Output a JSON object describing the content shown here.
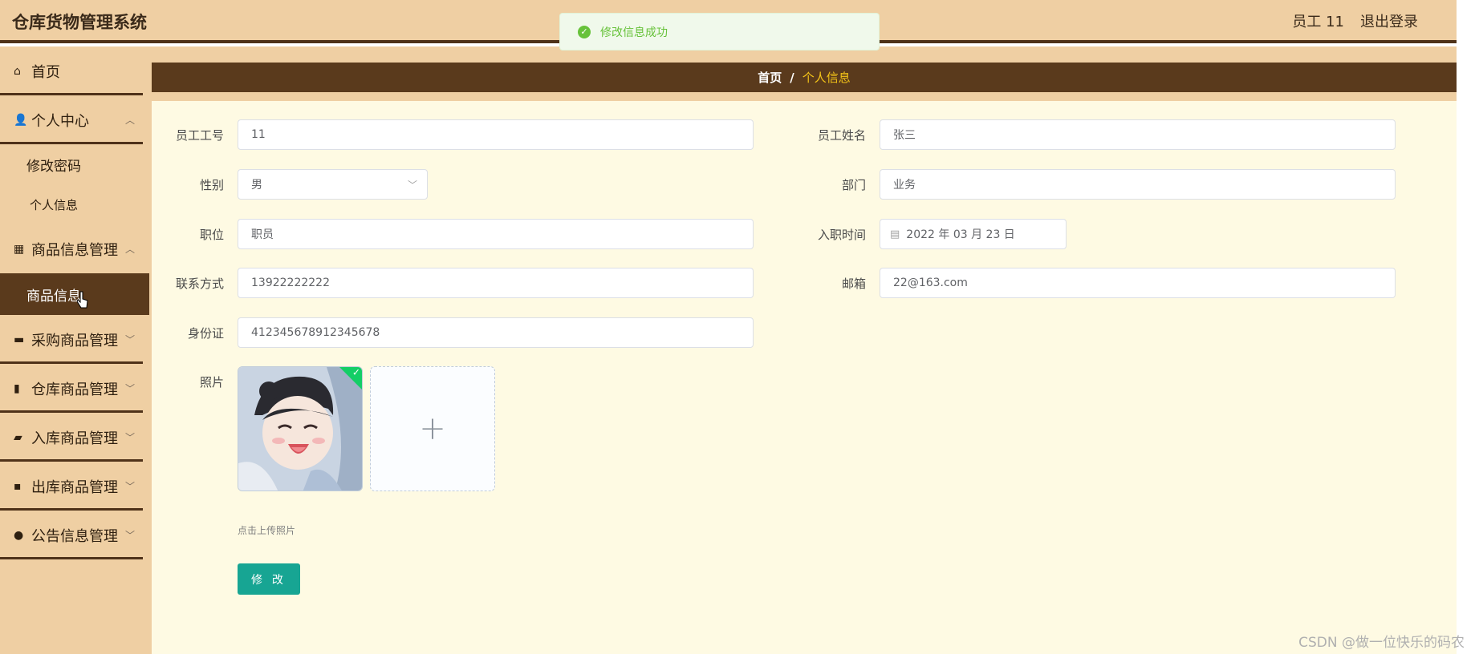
{
  "app": {
    "title": "仓库货物管理系统"
  },
  "header": {
    "user_label": "员工 11",
    "logout_label": "退出登录"
  },
  "toast": {
    "message": "修改信息成功",
    "icon": "check-circle-icon",
    "color": "#67c23a"
  },
  "sidebar": {
    "items": [
      {
        "label": "首页",
        "icon": "home-icon"
      },
      {
        "label": "个人中心",
        "icon": "user-icon",
        "expanded": true,
        "children": [
          {
            "label": "修改密码"
          },
          {
            "label": "个人信息"
          }
        ]
      },
      {
        "label": "商品信息管理",
        "icon": "grid-icon",
        "expanded": true,
        "children": [
          {
            "label": "商品信息",
            "active": true
          }
        ]
      },
      {
        "label": "采购商品管理",
        "icon": "briefcase-icon"
      },
      {
        "label": "仓库商品管理",
        "icon": "bar-chart-icon"
      },
      {
        "label": "入库商品管理",
        "icon": "ticket-icon"
      },
      {
        "label": "出库商品管理",
        "icon": "apps-icon"
      },
      {
        "label": "公告信息管理",
        "icon": "bulb-icon"
      }
    ]
  },
  "breadcrumb": {
    "home": "首页",
    "separator": "/",
    "current": "个人信息"
  },
  "form": {
    "employee_id": {
      "label": "员工工号",
      "value": "11"
    },
    "employee_name": {
      "label": "员工姓名",
      "value": "张三"
    },
    "gender": {
      "label": "性别",
      "value": "男"
    },
    "department": {
      "label": "部门",
      "value": "业务"
    },
    "position": {
      "label": "职位",
      "value": "职员"
    },
    "hire_date": {
      "label": "入职时间",
      "value": "2022 年 03 月 23 日"
    },
    "phone": {
      "label": "联系方式",
      "value": "13922222222"
    },
    "email": {
      "label": "邮箱",
      "value": "22@163.com"
    },
    "id_card": {
      "label": "身份证",
      "value": "412345678912345678"
    },
    "photo": {
      "label": "照片",
      "upload_hint": "点击上传照片"
    },
    "submit_label": "修 改"
  },
  "watermark": "CSDN @做一位快乐的码农",
  "colors": {
    "header_bg": "#efcfa3",
    "accent_dark": "#5a3a1c",
    "main_bg": "#fefae3",
    "button": "#17a593",
    "breadcrumb_current": "#f5c518"
  }
}
